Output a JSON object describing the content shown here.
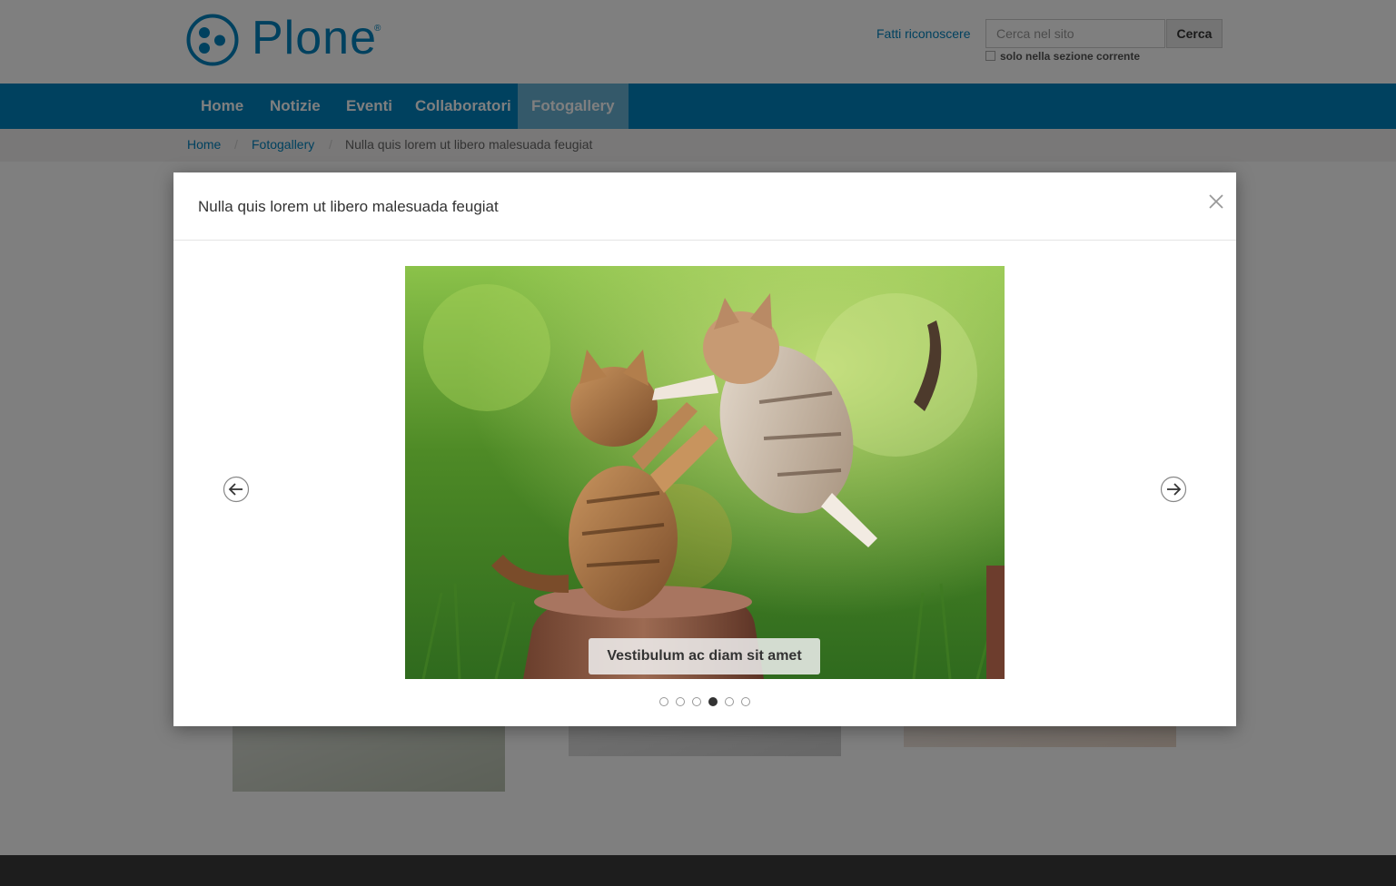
{
  "site": {
    "logo_text": "Plone",
    "logo_mark": "®",
    "login_link": "Fatti riconoscere",
    "search": {
      "placeholder": "Cerca nel sito",
      "button_label": "Cerca",
      "section_only_label": "solo nella sezione corrente"
    }
  },
  "nav": {
    "items": [
      {
        "label": "Home"
      },
      {
        "label": "Notizie"
      },
      {
        "label": "Eventi"
      },
      {
        "label": "Collaboratori"
      },
      {
        "label": "Fotogallery"
      }
    ],
    "active": "Fotogallery"
  },
  "breadcrumb": {
    "items": [
      {
        "label": "Home"
      },
      {
        "label": "Fotogallery"
      },
      {
        "label": "Nulla quis lorem ut libero malesuada feugiat"
      }
    ]
  },
  "modal": {
    "title": "Nulla quis lorem ut libero malesuada feugiat",
    "caption": "Vestibulum ac diam sit amet",
    "slide_count": 6,
    "active_slide": 4,
    "image_subject": "two kittens playing on a tree stump in green grass"
  },
  "colors": {
    "brand_blue": "#0083be",
    "nav_active": "#69b3d5",
    "overlay": "rgba(0,0,0,0.5)"
  }
}
